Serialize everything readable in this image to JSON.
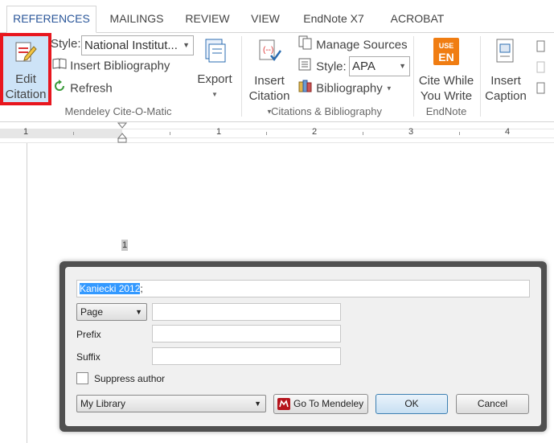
{
  "tabs": [
    {
      "label": "REFERENCES",
      "active": true
    },
    {
      "label": "MAILINGS"
    },
    {
      "label": "REVIEW"
    },
    {
      "label": "VIEW"
    },
    {
      "label": "EndNote X7"
    },
    {
      "label": "ACROBAT"
    }
  ],
  "mendeley": {
    "edit_citation_line1": "Edit",
    "edit_citation_line2": "Citation",
    "style_label": "Style:",
    "style_value": "National Institut...",
    "insert_bibliography": "Insert Bibliography",
    "refresh": "Refresh",
    "export": "Export",
    "group_label": "Mendeley Cite-O-Matic"
  },
  "citations": {
    "insert_citation_line1": "Insert",
    "insert_citation_line2": "Citation",
    "manage_sources": "Manage Sources",
    "style_label": "Style:",
    "style_value": "APA",
    "bibliography": "Bibliography",
    "group_label": "Citations & Bibliography"
  },
  "endnote": {
    "icon_text_top": "USE",
    "icon_text_bottom": "EN",
    "cite_line1": "Cite While",
    "cite_line2": "You Write",
    "group_label": "EndNote"
  },
  "captions": {
    "insert_caption_line1": "Insert",
    "insert_caption_line2": "Caption"
  },
  "ruler": {
    "numbers": [
      "1",
      "1",
      "2",
      "3",
      "4"
    ]
  },
  "document": {
    "line_number": "1"
  },
  "dialog": {
    "citation_selected": "Kaniecki 2012",
    "citation_suffix": ";",
    "locator_type": "Page",
    "locator_value": "",
    "prefix_label": "Prefix",
    "prefix_value": "",
    "suffix_label": "Suffix",
    "suffix_value": "",
    "suppress_author_label": "Suppress author",
    "suppress_author_checked": false,
    "library": "My Library",
    "go_to_mendeley": "Go To Mendeley",
    "ok": "OK",
    "cancel": "Cancel"
  },
  "colors": {
    "accent": "#2b579a",
    "highlight_border": "#e8161e",
    "endnote_orange": "#f07d12",
    "selection": "#3399ff"
  }
}
